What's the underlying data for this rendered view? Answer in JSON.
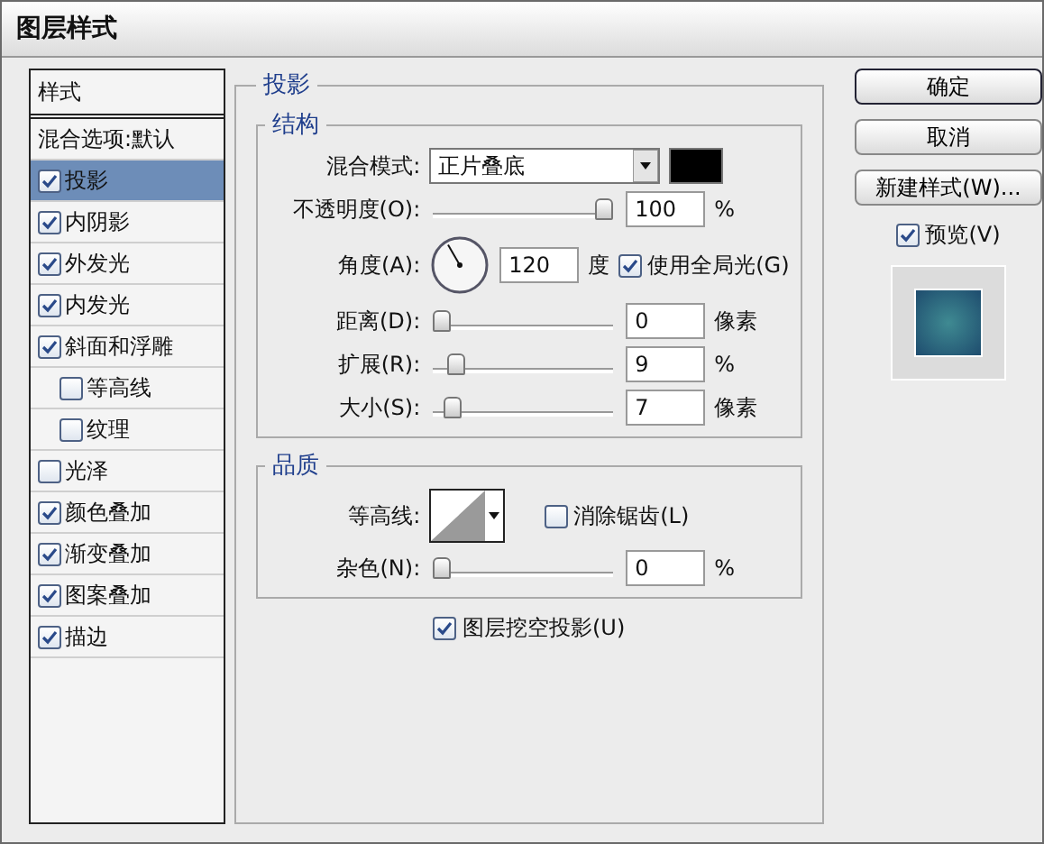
{
  "window": {
    "title": "图层样式"
  },
  "sidebar": {
    "header": "样式",
    "items": [
      {
        "kind": "plain",
        "label": "混合选项:默认",
        "selected": false
      },
      {
        "kind": "check",
        "label": "投影",
        "checked": true,
        "selected": true
      },
      {
        "kind": "check",
        "label": "内阴影",
        "checked": true,
        "selected": false
      },
      {
        "kind": "check",
        "label": "外发光",
        "checked": true,
        "selected": false
      },
      {
        "kind": "check",
        "label": "内发光",
        "checked": true,
        "selected": false
      },
      {
        "kind": "check",
        "label": "斜面和浮雕",
        "checked": true,
        "selected": false,
        "children": [
          {
            "kind": "check",
            "label": "等高线",
            "checked": false,
            "selected": false
          },
          {
            "kind": "check",
            "label": "纹理",
            "checked": false,
            "selected": false
          }
        ]
      },
      {
        "kind": "check",
        "label": "光泽",
        "checked": false,
        "selected": false
      },
      {
        "kind": "check",
        "label": "颜色叠加",
        "checked": true,
        "selected": false
      },
      {
        "kind": "check",
        "label": "渐变叠加",
        "checked": true,
        "selected": false
      },
      {
        "kind": "check",
        "label": "图案叠加",
        "checked": true,
        "selected": false
      },
      {
        "kind": "check",
        "label": "描边",
        "checked": true,
        "selected": false
      }
    ]
  },
  "panel": {
    "title": "投影",
    "structure": {
      "title": "结构",
      "blend_mode": {
        "label": "混合模式:",
        "value": "正片叠底",
        "color": "#000000"
      },
      "opacity": {
        "label": "不透明度(O):",
        "level": 1,
        "value": "100",
        "unit": "%"
      },
      "angle": {
        "label": "角度(A):",
        "value": "120",
        "unit": "度",
        "global_light": {
          "label": "使用全局光(G)",
          "checked": true
        }
      },
      "sliders": [
        {
          "label": "距离(D):",
          "level": 0,
          "value": "0",
          "unit": "像素"
        },
        {
          "label": "扩展(R):",
          "level": 0.09,
          "value": "9",
          "unit": "%"
        },
        {
          "label": "大小(S):",
          "level": 0.07,
          "value": "7",
          "unit": "像素"
        }
      ]
    },
    "quality": {
      "title": "品质",
      "contour": {
        "label": "等高线:"
      },
      "anti_alias": {
        "label": "消除锯齿(L)",
        "checked": false
      },
      "noise": {
        "label": "杂色(N):",
        "level": 0,
        "value": "0",
        "unit": "%"
      }
    },
    "knockout": {
      "label": "图层挖空投影(U)",
      "checked": true
    }
  },
  "buttons": [
    {
      "label": "确定",
      "default": true
    },
    {
      "label": "取消",
      "default": false
    },
    {
      "label": "新建样式(W)...",
      "default": false
    }
  ],
  "preview": {
    "label": "预览(V)",
    "checked": true
  }
}
